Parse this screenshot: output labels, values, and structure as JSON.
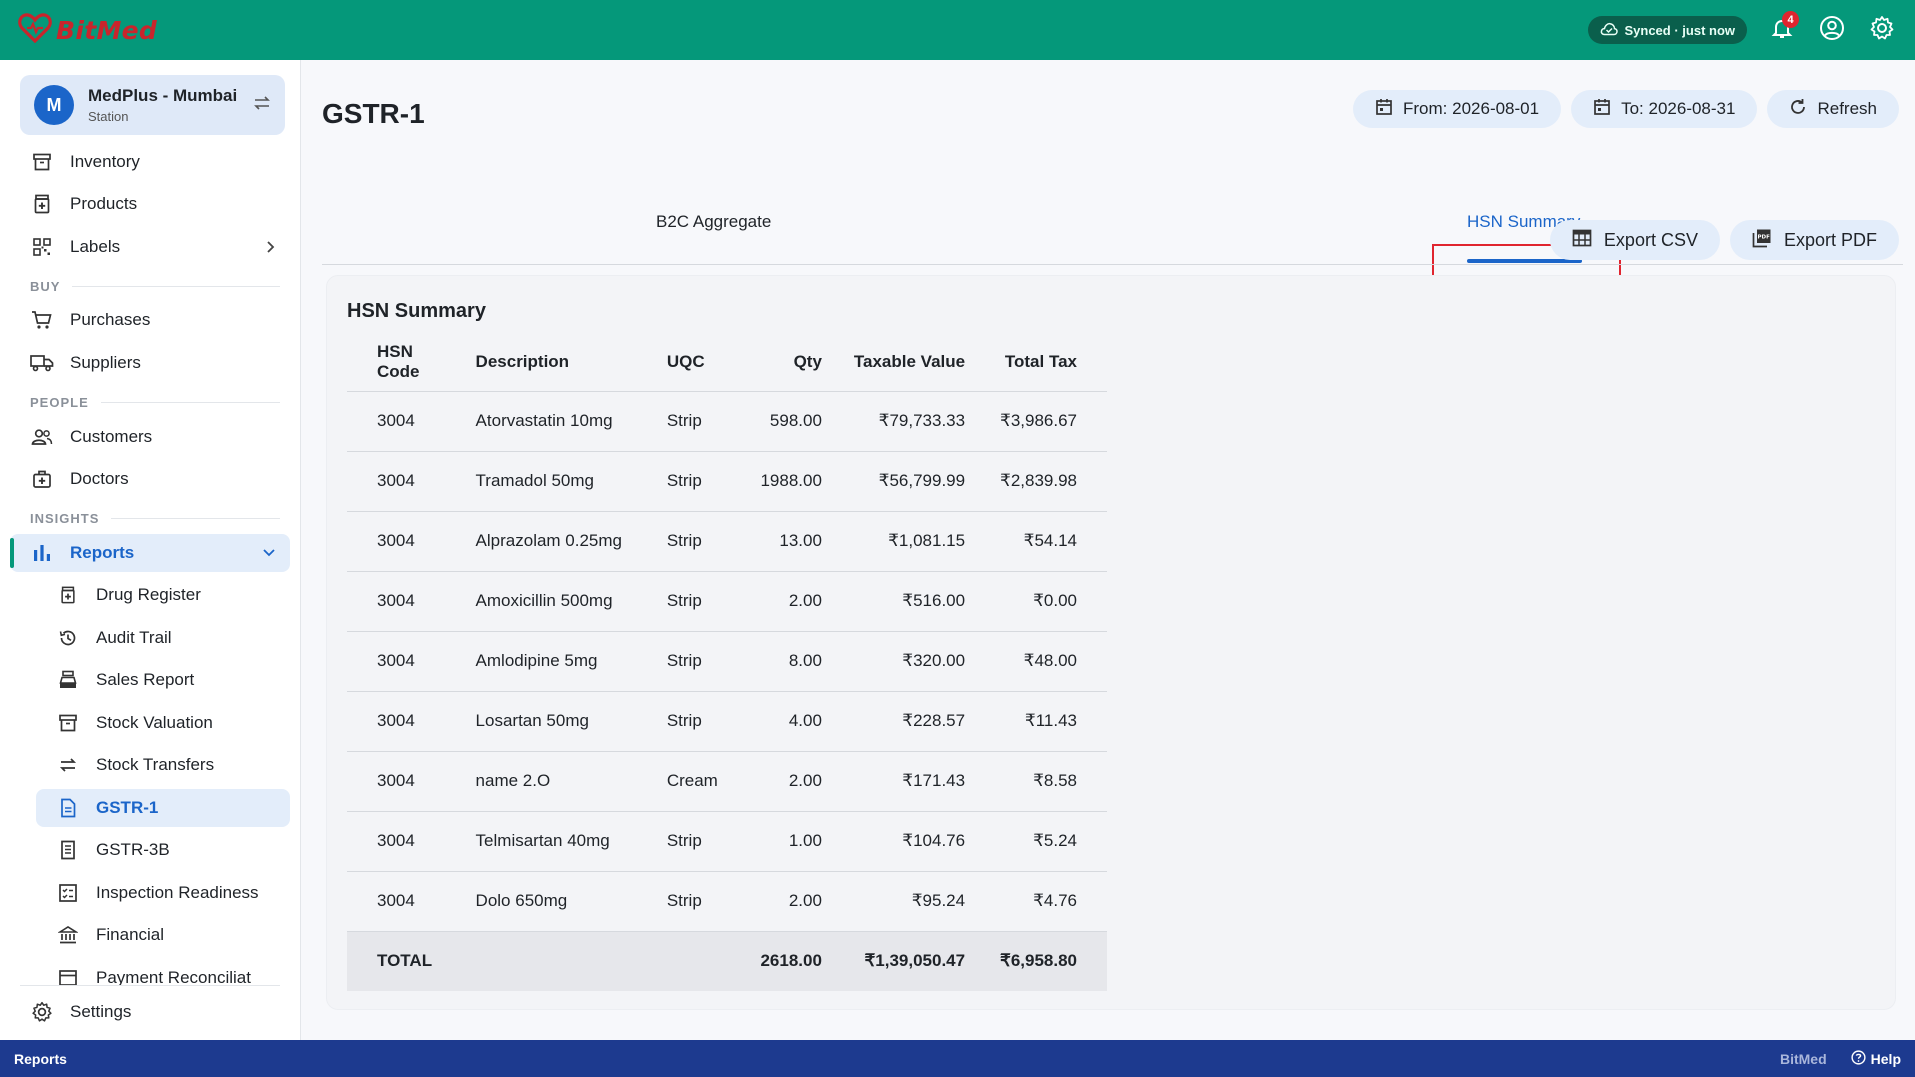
{
  "app": {
    "brand": "BitMed"
  },
  "topbar": {
    "sync_status": "Synced · just now",
    "notifications_count": "4"
  },
  "station": {
    "initial": "M",
    "name": "MedPlus - Mumbai",
    "subtitle": "Station"
  },
  "sidebar": {
    "items": [
      {
        "label": "Inventory"
      },
      {
        "label": "Products"
      },
      {
        "label": "Labels"
      }
    ],
    "section_buy": "BUY",
    "buy_items": [
      {
        "label": "Purchases"
      },
      {
        "label": "Suppliers"
      }
    ],
    "section_people": "PEOPLE",
    "people_items": [
      {
        "label": "Customers"
      },
      {
        "label": "Doctors"
      }
    ],
    "section_insights": "INSIGHTS",
    "reports_label": "Reports",
    "report_items": [
      {
        "label": "Drug Register"
      },
      {
        "label": "Audit Trail"
      },
      {
        "label": "Sales Report"
      },
      {
        "label": "Stock Valuation"
      },
      {
        "label": "Stock Transfers"
      },
      {
        "label": "GSTR-1"
      },
      {
        "label": "GSTR-3B"
      },
      {
        "label": "Inspection Readiness"
      },
      {
        "label": "Financial"
      },
      {
        "label": "Payment Reconciliat"
      }
    ],
    "settings_label": "Settings"
  },
  "page": {
    "title": "GSTR-1",
    "from_label": "From: 2026-08-01",
    "to_label": "To: 2026-08-31",
    "refresh_label": "Refresh",
    "tabs": [
      {
        "label": "B2C Aggregate"
      },
      {
        "label": "HSN Summary"
      }
    ],
    "export_csv": "Export CSV",
    "export_pdf": "Export PDF"
  },
  "hsn_summary": {
    "title": "HSN Summary",
    "columns": [
      "HSN Code",
      "Description",
      "UQC",
      "Qty",
      "Taxable Value",
      "Total Tax"
    ],
    "rows": [
      [
        "3004",
        "Atorvastatin 10mg",
        "Strip",
        "598.00",
        "₹79,733.33",
        "₹3,986.67"
      ],
      [
        "3004",
        "Tramadol 50mg",
        "Strip",
        "1988.00",
        "₹56,799.99",
        "₹2,839.98"
      ],
      [
        "3004",
        "Alprazolam 0.25mg",
        "Strip",
        "13.00",
        "₹1,081.15",
        "₹54.14"
      ],
      [
        "3004",
        "Amoxicillin 500mg",
        "Strip",
        "2.00",
        "₹516.00",
        "₹0.00"
      ],
      [
        "3004",
        "Amlodipine 5mg",
        "Strip",
        "8.00",
        "₹320.00",
        "₹48.00"
      ],
      [
        "3004",
        "Losartan 50mg",
        "Strip",
        "4.00",
        "₹228.57",
        "₹11.43"
      ],
      [
        "3004",
        "name 2.O",
        "Cream",
        "2.00",
        "₹171.43",
        "₹8.58"
      ],
      [
        "3004",
        "Telmisartan 40mg",
        "Strip",
        "1.00",
        "₹104.76",
        "₹5.24"
      ],
      [
        "3004",
        "Dolo 650mg",
        "Strip",
        "2.00",
        "₹95.24",
        "₹4.76"
      ]
    ],
    "total": {
      "label": "TOTAL",
      "qty": "2618.00",
      "taxable": "₹1,39,050.47",
      "tax": "₹6,958.80"
    }
  },
  "footer": {
    "left": "Reports",
    "brand": "BitMed",
    "help": "Help"
  },
  "colors": {
    "header": "#05987a",
    "footer": "#1d3a8f",
    "accent": "#1b65c9",
    "highlight": "#e0252f"
  }
}
